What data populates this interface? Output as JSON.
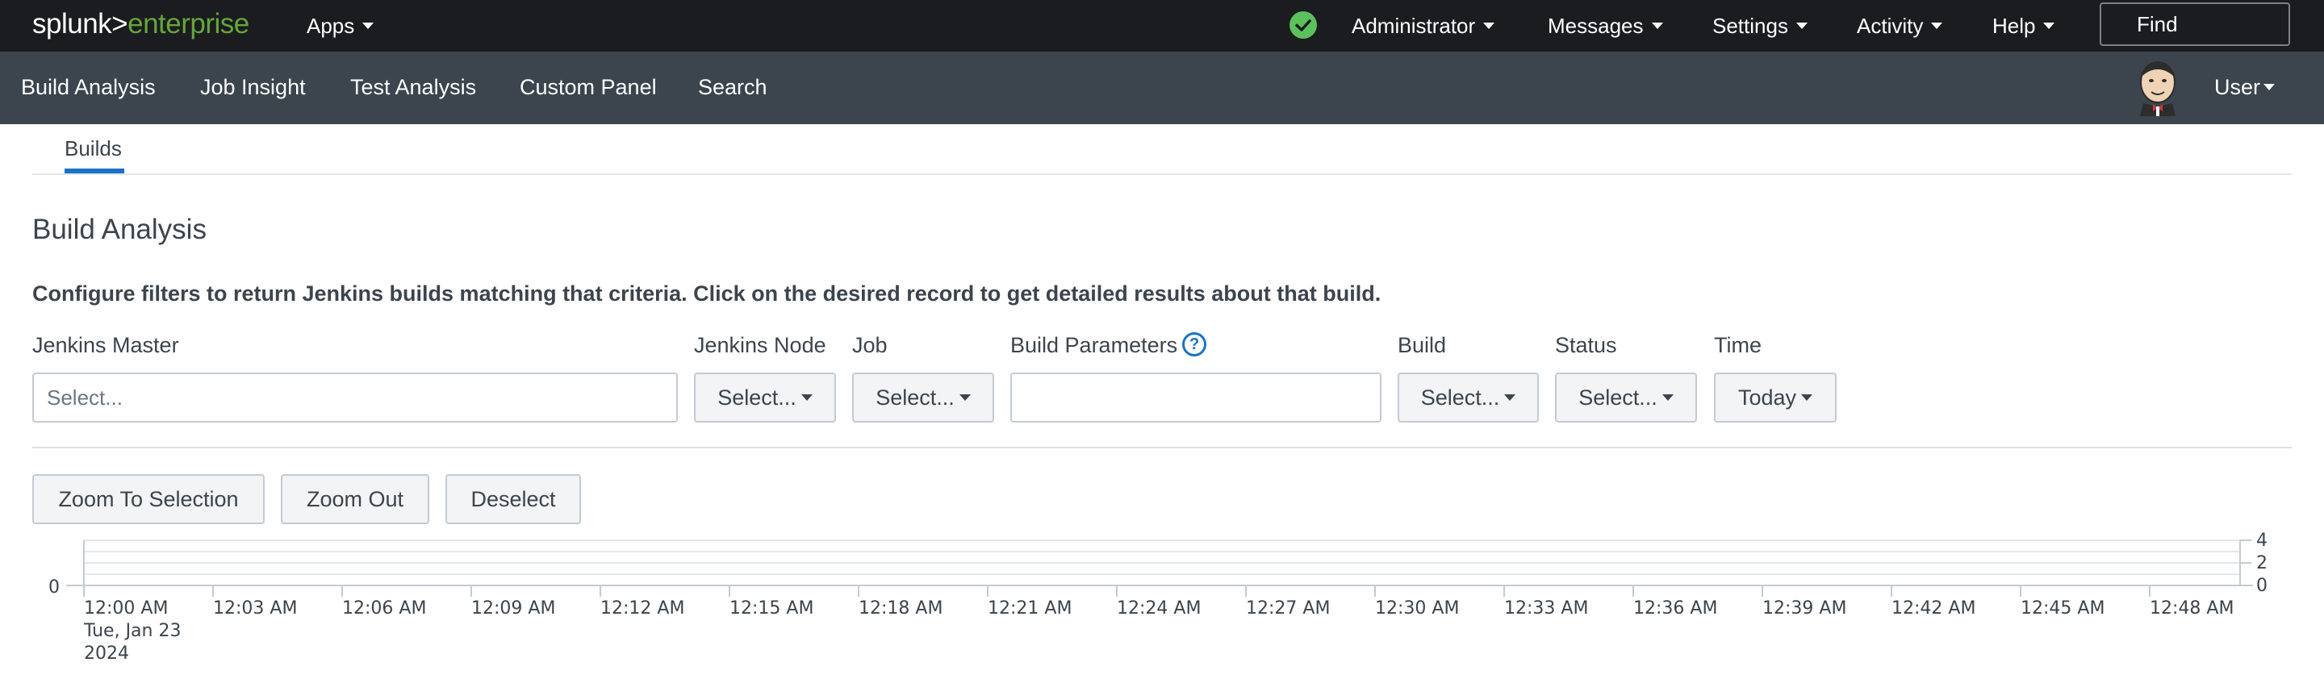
{
  "topbar": {
    "logo_primary": "splunk>",
    "logo_secondary": "enterprise",
    "apps": "Apps",
    "administrator": "Administrator",
    "messages": "Messages",
    "settings": "Settings",
    "activity": "Activity",
    "help": "Help",
    "find": "Find"
  },
  "appbar": {
    "nav": [
      "Build Analysis",
      "Job Insight",
      "Test Analysis",
      "Custom Panel",
      "Search"
    ],
    "user": "User"
  },
  "tabs": {
    "active": "Builds"
  },
  "page": {
    "title": "Build Analysis",
    "description": "Configure filters to return Jenkins builds matching that criteria. Click on the desired record to get detailed results about that build."
  },
  "filters": {
    "jenkins_master": {
      "label": "Jenkins Master",
      "placeholder": "Select..."
    },
    "jenkins_node": {
      "label": "Jenkins Node",
      "value": "Select..."
    },
    "job": {
      "label": "Job",
      "value": "Select..."
    },
    "build_parameters": {
      "label": "Build Parameters",
      "help": "?",
      "value": ""
    },
    "build": {
      "label": "Build",
      "value": "Select..."
    },
    "status": {
      "label": "Status",
      "value": "Select..."
    },
    "time": {
      "label": "Time",
      "value": "Today"
    }
  },
  "buttons": {
    "zoom_to_selection": "Zoom To Selection",
    "zoom_out": "Zoom Out",
    "deselect": "Deselect"
  },
  "timeline": {
    "left_axis": [
      "0"
    ],
    "right_axis": [
      "4",
      "2",
      "0"
    ],
    "first_tick_date": "Tue, Jan 23",
    "first_tick_year": "2024",
    "ticks": [
      "12:00 AM",
      "12:03 AM",
      "12:06 AM",
      "12:09 AM",
      "12:12 AM",
      "12:15 AM",
      "12:18 AM",
      "12:21 AM",
      "12:24 AM",
      "12:27 AM",
      "12:30 AM",
      "12:33 AM",
      "12:36 AM",
      "12:39 AM",
      "12:42 AM",
      "12:45 AM",
      "12:48 AM"
    ]
  },
  "colors": {
    "accent": "#1a73c7",
    "brand_green": "#65a637",
    "status_ok": "#5cc05c",
    "topbar_bg": "#1a1c20",
    "appbar_bg": "#3c444d"
  }
}
